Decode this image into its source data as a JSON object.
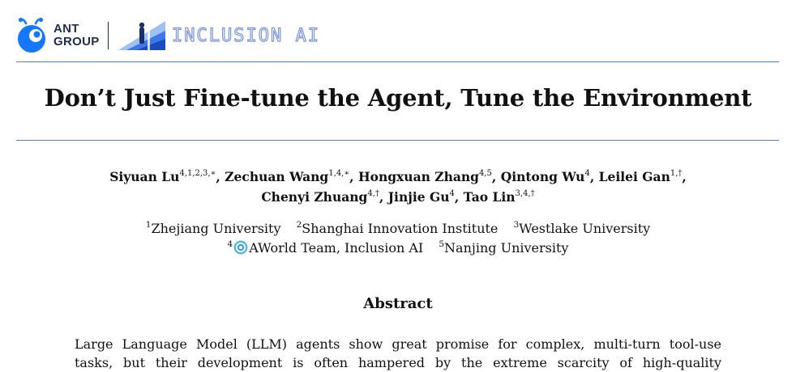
{
  "header": {
    "org_logo_line1": "ANT",
    "org_logo_line2": "GROUP",
    "lab_logo_text": "INCLUSION AI",
    "brand_blue": "#1677ff",
    "inclusion_color": "#7b93d8"
  },
  "title": "Don’t Just Fine-tune the Agent, Tune the Environment",
  "authors": [
    {
      "name": "Siyuan Lu",
      "sup": "4,1,2,3,∗",
      "sep": ", "
    },
    {
      "name": "Zechuan Wang",
      "sup": "1,4,∗",
      "sep": ", "
    },
    {
      "name": "Hongxuan Zhang",
      "sup": "4,5",
      "sep": ", "
    },
    {
      "name": "Qintong Wu",
      "sup": "4",
      "sep": ", "
    },
    {
      "name": "Leilei Gan",
      "sup": "1,†",
      "sep": ","
    },
    {
      "name": "Chenyi Zhuang",
      "sup": "4,†",
      "sep": ", "
    },
    {
      "name": "Jinjie Gu",
      "sup": "4",
      "sep": ", "
    },
    {
      "name": "Tao Lin",
      "sup": "3,4,†",
      "sep": ""
    }
  ],
  "affiliations": [
    {
      "num": "1",
      "name": "Zhejiang University"
    },
    {
      "num": "2",
      "name": "Shanghai Innovation Institute"
    },
    {
      "num": "3",
      "name": "Westlake University"
    },
    {
      "num": "4",
      "name": "AWorld Team, Inclusion AI"
    },
    {
      "num": "5",
      "name": "Nanjing University"
    }
  ],
  "abstract": {
    "heading": "Abstract",
    "lines": [
      "Large Language Model (LLM) agents show great promise for complex, multi-turn tool-use",
      "tasks, but their development is often hampered by the extreme scarcity of high-quality"
    ]
  }
}
